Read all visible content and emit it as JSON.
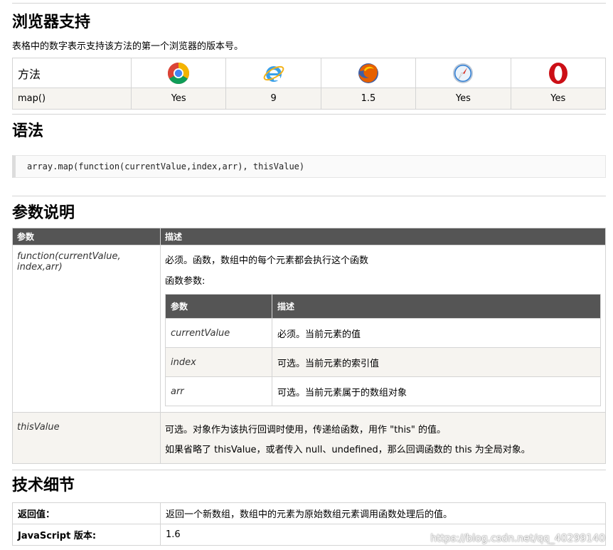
{
  "browser_support": {
    "title": "浏览器支持",
    "description": "表格中的数字表示支持该方法的第一个浏览器的版本号。",
    "header_first": "方法",
    "browsers": [
      {
        "icon": "chrome-icon"
      },
      {
        "icon": "internet-explorer-icon"
      },
      {
        "icon": "firefox-icon"
      },
      {
        "icon": "safari-icon"
      },
      {
        "icon": "opera-icon"
      }
    ],
    "row_method": "map()",
    "row_values": [
      "Yes",
      "9",
      "1.5",
      "Yes",
      "Yes"
    ]
  },
  "syntax": {
    "title": "语法",
    "code": "array.map(function(currentValue,index,arr), thisValue)"
  },
  "params": {
    "title": "参数说明",
    "col_param": "参数",
    "col_desc": "描述",
    "row1_param": "function(currentValue, index,arr)",
    "row1_desc_line1": "必须。函数，数组中的每个元素都会执行这个函数",
    "row1_desc_line2": "函数参数:",
    "inner": {
      "col_param": "参数",
      "col_desc": "描述",
      "rows": [
        {
          "param": "currentValue",
          "desc": "必须。当前元素的值"
        },
        {
          "param": "index",
          "desc": "可选。当前元素的索引值"
        },
        {
          "param": "arr",
          "desc": "可选。当前元素属于的数组对象"
        }
      ]
    },
    "row2_param": "thisValue",
    "row2_desc_line1": "可选。对象作为该执行回调时使用，传递给函数，用作 \"this\" 的值。",
    "row2_desc_line2": "如果省略了 thisValue，或者传入 null、undefined，那么回调函数的 this 为全局对象。"
  },
  "tech": {
    "title": "技术细节",
    "rows": [
      {
        "key": "返回值：",
        "value": "返回一个新数组，数组中的元素为原始数组元素调用函数处理后的值。"
      },
      {
        "key": "JavaScript 版本:",
        "value": "1.6"
      }
    ]
  },
  "watermark": "https://blog.csdn.net/qq_40299140"
}
